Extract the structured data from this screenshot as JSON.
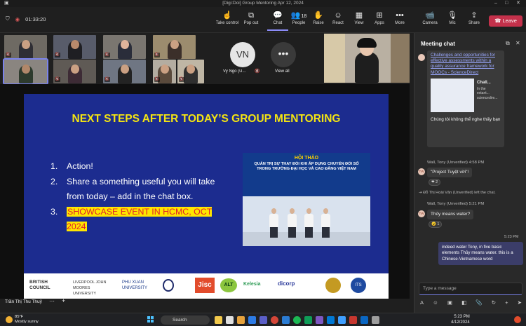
{
  "window": {
    "title": "[Digi:Doi] Group Mentoring Apr 12, 2024"
  },
  "toolbar": {
    "timer": "01:33:20",
    "take_control": "Take control",
    "pop_out": "Pop out",
    "chat": "Chat",
    "people": "People",
    "people_count": "18",
    "raise": "Raise",
    "react": "React",
    "view": "View",
    "apps": "Apps",
    "more": "More",
    "camera": "Camera",
    "mic": "Mic",
    "share": "Share",
    "leave": "Leave"
  },
  "participants": {
    "vn_initials": "VN",
    "vn_name": "Vy Ngo (U...",
    "view_all": "View all"
  },
  "slide": {
    "title": "NEXT STEPS AFTER TODAY’S GROUP MENTORING",
    "items": [
      {
        "num": "1.",
        "text": "Action!"
      },
      {
        "num": "2.",
        "text": "Share a something useful you will take from today – add in the chat box."
      },
      {
        "num": "3.",
        "text": "SHOWCASE EVENT IN HCMC, OCT 2024"
      }
    ],
    "photo": {
      "heading": "HỘI THẢO",
      "subheading": "QUẢN TRỊ SỰ THAY ĐỔI KHI ÁP DỤNG CHUYỂN ĐỔI SỐ TRONG TRƯỜNG ĐẠI HỌC VÀ CAO ĐẲNG VIỆT NAM"
    },
    "logos": [
      "BRITISH COUNCIL",
      "LIVERPOOL JOHN MOORES UNIVERSITY",
      "PHU XUAN UNIVERSITY",
      "Jisc",
      "ALT",
      "Kelesia",
      "dicorp",
      "ITS"
    ]
  },
  "presenter_name": "Trần Thị Thu Thuỷ",
  "chat": {
    "title": "Meeting chat",
    "link_text": "Challenges and opportunities for effective assessments within a quality assurance framework for MOOCs - ScienceDirect",
    "preview_title": "Chall...",
    "preview_snippet": "In the extant... sciencedire...",
    "msg_vi": "Chúng tôi không thể nghe thấy bạn",
    "meta1": "Wall, Tony (Unverified)   4:58 PM",
    "msg1": "\"Project Tuyệt vời\"!",
    "react1": "❤ 2",
    "sys1": "Đỗ Thị Hoài Vân (Unverified) left the chat.",
    "meta2": "Wall, Tony (Unverified)   5:21 PM",
    "msg2": "Thủy means water?",
    "react2": "😮 1",
    "mine_time": "5:23 PM",
    "mine": "indeed water Tony, in five basic elements Thủy means water. this is a Chinese-Vietnamese word",
    "avatar": "TW",
    "compose_placeholder": "Type a message"
  },
  "taskbar": {
    "temp": "85°F",
    "weather": "Mostly sunny",
    "search": "Search",
    "time": "5:23 PM",
    "date": "4/12/2024"
  }
}
